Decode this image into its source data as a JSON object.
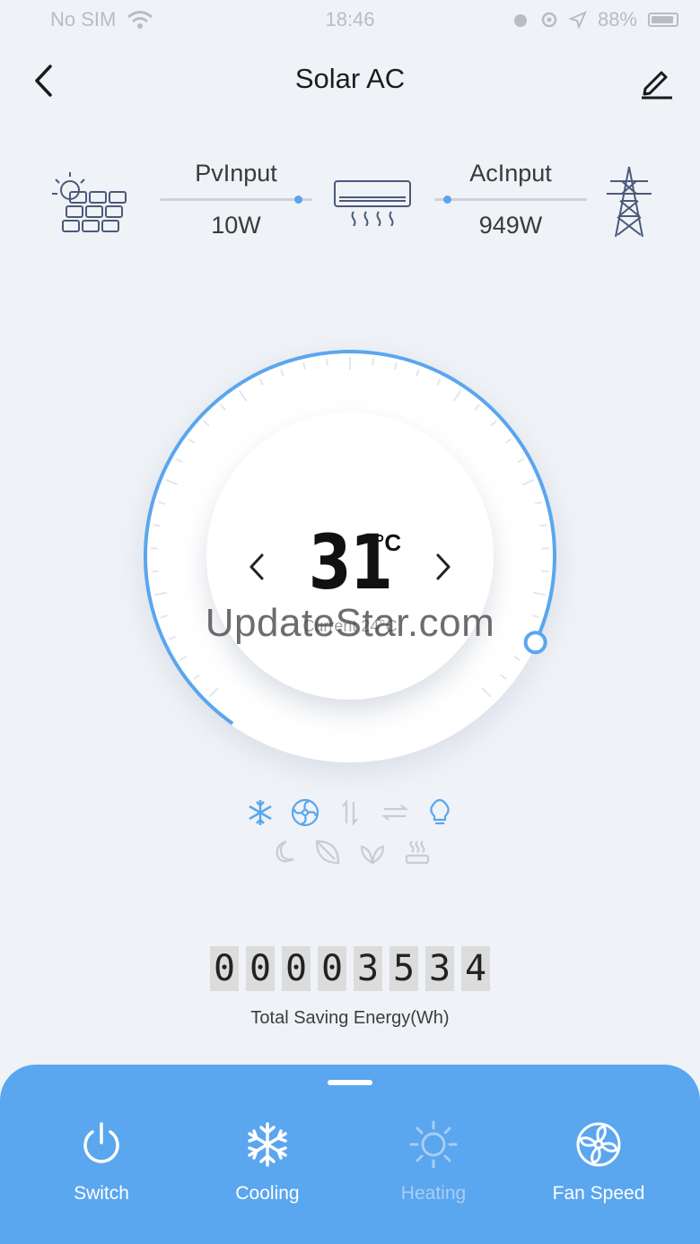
{
  "status_bar": {
    "carrier": "No SIM",
    "time": "18:46",
    "battery": "88%"
  },
  "nav": {
    "title": "Solar AC"
  },
  "power_flow": {
    "pv": {
      "label": "PvInput",
      "value": "10W"
    },
    "ac": {
      "label": "AcInput",
      "value": "949W"
    }
  },
  "thermostat": {
    "set_temp": "31",
    "unit": "°C",
    "current": "Current 24°C"
  },
  "watermark": "UpdateStar.com",
  "counter": {
    "digits": [
      "0",
      "0",
      "0",
      "0",
      "3",
      "5",
      "3",
      "4"
    ],
    "label": "Total Saving Energy(Wh)"
  },
  "controls": [
    {
      "label": "Switch",
      "icon": "power-icon",
      "enabled": true
    },
    {
      "label": "Cooling",
      "icon": "snowflake-icon",
      "enabled": true
    },
    {
      "label": "Heating",
      "icon": "sun-icon",
      "enabled": false
    },
    {
      "label": "Fan Speed",
      "icon": "fan-icon",
      "enabled": true
    }
  ],
  "colors": {
    "accent": "#5aa6ef",
    "background": "#eff2f6",
    "inactive": "#c9ccd2"
  }
}
